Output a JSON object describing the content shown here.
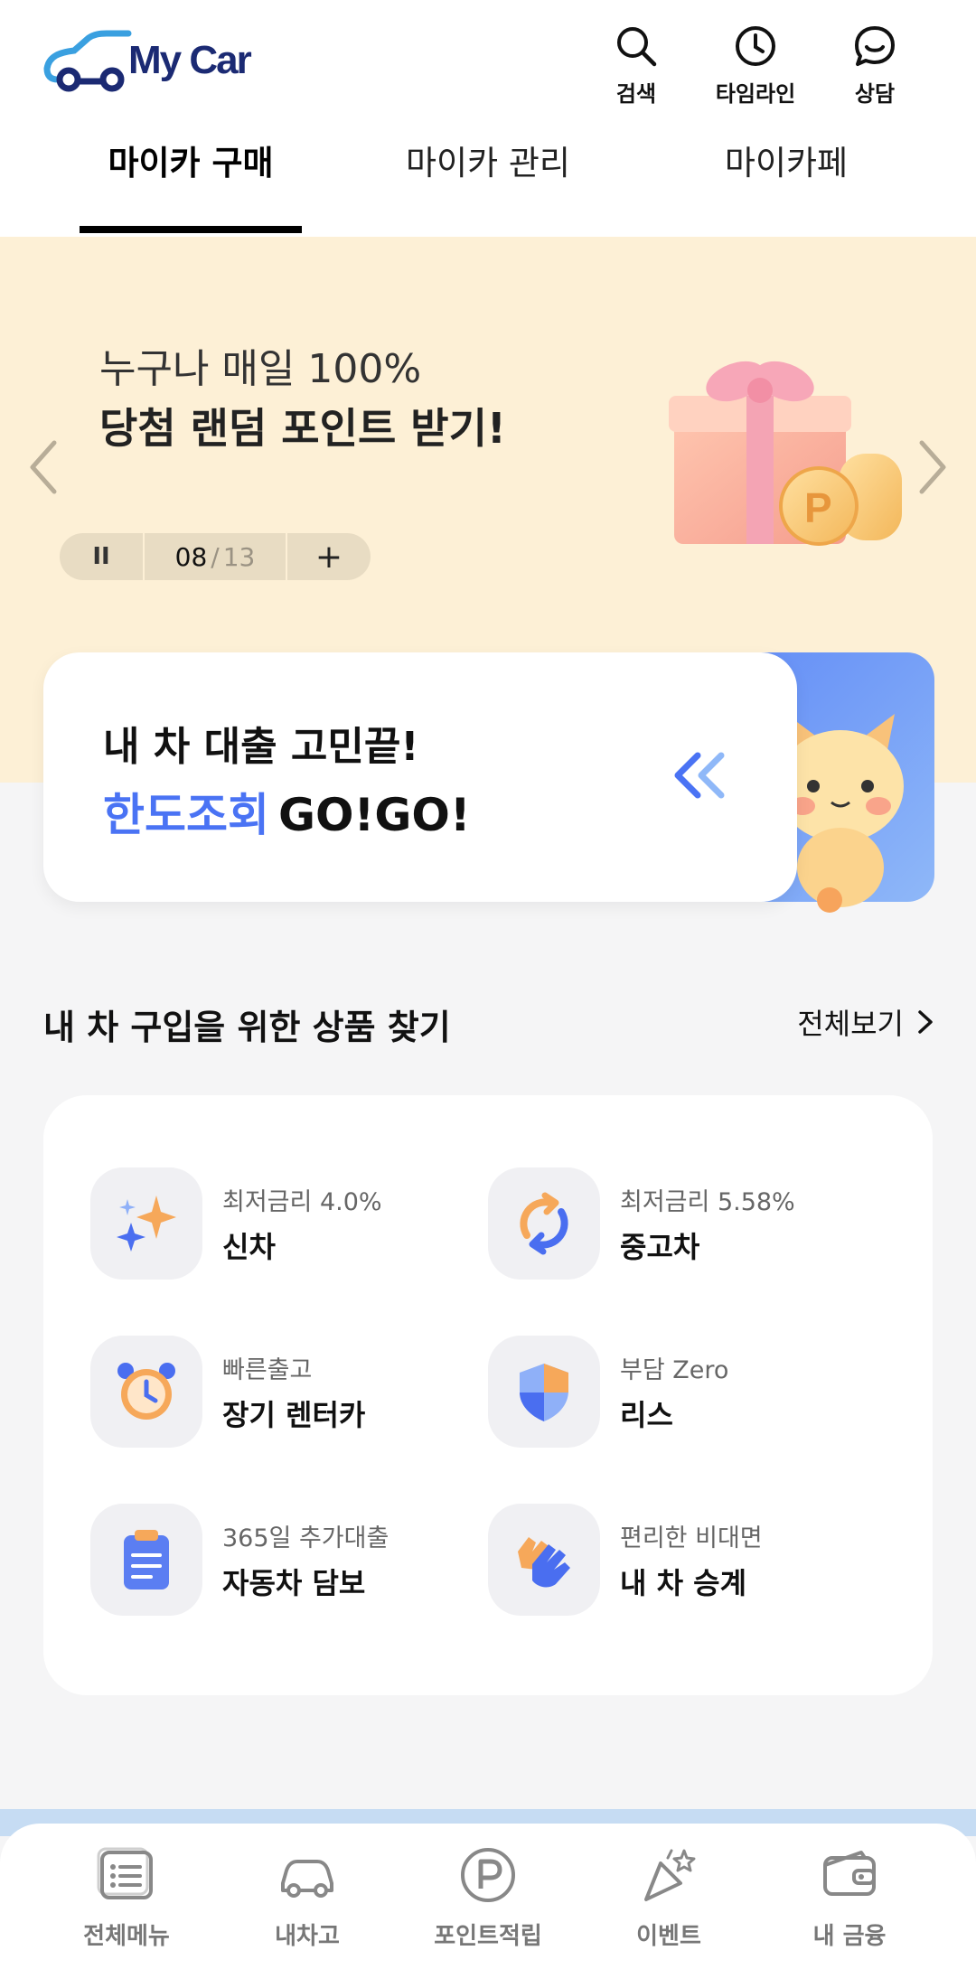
{
  "header": {
    "logo_text": "My Car",
    "icons": [
      {
        "name": "search-icon",
        "label": "검색"
      },
      {
        "name": "clock-icon",
        "label": "타임라인"
      },
      {
        "name": "chat-icon",
        "label": "상담"
      }
    ]
  },
  "tabs": [
    {
      "label": "마이카 구매",
      "active": true
    },
    {
      "label": "마이카 관리",
      "active": false
    },
    {
      "label": "마이카페",
      "active": false
    }
  ],
  "banner": {
    "line1": "누구나 매일 100%",
    "line2": "당첨 랜덤 포인트 받기!",
    "current": "08",
    "separator": "/",
    "total": "13",
    "pause_symbol": "II",
    "plus_symbol": "+",
    "background": "#fdf0d6"
  },
  "loan": {
    "line1": "내 차 대출 고민끝!",
    "line2_highlight": "한도조회",
    "line2_rest": "GO!GO!",
    "accent": "#4a73f4"
  },
  "products": {
    "title": "내 차 구입을 위한 상품 찾기",
    "see_all": "전체보기",
    "items": [
      {
        "icon": "sparkle-icon",
        "sub": "최저금리 4.0%",
        "name": "신차"
      },
      {
        "icon": "refresh-icon",
        "sub": "최저금리 5.58%",
        "name": "중고차"
      },
      {
        "icon": "alarm-clock-icon",
        "sub": "빠른출고",
        "name": "장기 렌터카"
      },
      {
        "icon": "shield-icon",
        "sub": "부담 Zero",
        "name": "리스"
      },
      {
        "icon": "clipboard-icon",
        "sub": "365일 추가대출",
        "name": "자동차 담보"
      },
      {
        "icon": "hands-icon",
        "sub": "편리한 비대면",
        "name": "내 차 승계"
      }
    ]
  },
  "bottom_nav": [
    {
      "icon": "menu-list-icon",
      "label": "전체메뉴"
    },
    {
      "icon": "car-icon",
      "label": "내차고"
    },
    {
      "icon": "point-icon",
      "label": "포인트적립"
    },
    {
      "icon": "party-icon",
      "label": "이벤트"
    },
    {
      "icon": "wallet-icon",
      "label": "내 금융"
    }
  ]
}
